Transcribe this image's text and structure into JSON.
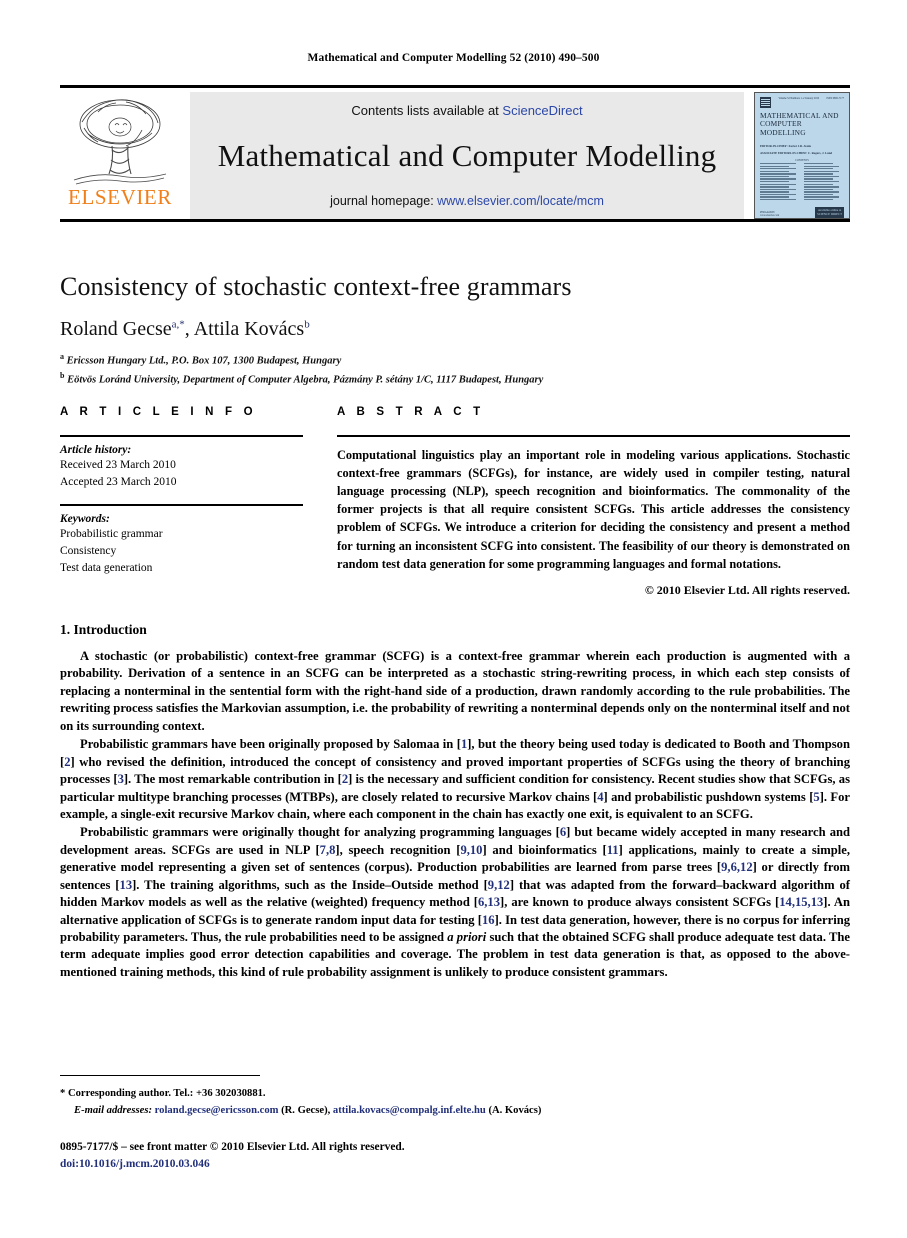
{
  "running_head": "Mathematical and Computer Modelling 52 (2010) 490–500",
  "masthead": {
    "contents_prefix": "Contents lists available at ",
    "sciencedirect": "ScienceDirect",
    "journal_title": "Mathematical and Computer Modelling",
    "homepage_prefix": "journal homepage: ",
    "homepage_url": "www.elsevier.com/locate/mcm",
    "publisher_wordmark": "ELSEVIER",
    "publisher_color": "#F07F1A",
    "link_color": "#2b47a8",
    "band_background": "#e9e9e9",
    "cover": {
      "volume_line": "Volume 52 Numbers 1–2 January 2010",
      "issn_line": "ISSN 0895-7177",
      "title": "MATHEMATICAL AND COMPUTER MODELLING",
      "editors_line_1": "EDITOR-IN-CHIEF: Xavier J.R. Avula",
      "editors_line_2": "ASSOCIATE EDITORS-IN-CHIEF: C. Rogers, J. Lund",
      "contents_label": "CONTENTS",
      "publisher": "PERGAMON",
      "publisher_sub": "www.elsevier.com",
      "badge_line_1": "Available online at",
      "badge_line_2": "SCIENCE DIRECT",
      "background_color": "#bcd6ea"
    }
  },
  "article": {
    "title": "Consistency of stochastic context-free grammars",
    "authors": [
      {
        "name": "Roland Gecse",
        "marks": "a,",
        "corresponding": "*"
      },
      {
        "name": "Attila Kovács",
        "marks": "b",
        "corresponding": ""
      }
    ],
    "author_separator": ", ",
    "affiliations": [
      {
        "mark": "a",
        "text": "Ericsson Hungary Ltd., P.O. Box 107, 1300 Budapest, Hungary"
      },
      {
        "mark": "b",
        "text": "Eötvös Loránd University, Department of Computer Algebra, Pázmány P. sétány 1/C, 1117 Budapest, Hungary"
      }
    ]
  },
  "article_info": {
    "heading": "A R T I C L E   I N F O",
    "history_label": "Article history:",
    "history": [
      "Received 23 March 2010",
      "Accepted 23 March 2010"
    ],
    "keywords_label": "Keywords:",
    "keywords": [
      "Probabilistic grammar",
      "Consistency",
      "Test data generation"
    ]
  },
  "abstract": {
    "heading": "A B S T R A C T",
    "text": "Computational linguistics play an important role in modeling various applications. Stochastic context-free grammars (SCFGs), for instance, are widely used in compiler testing, natural language processing (NLP), speech recognition and bioinformatics. The commonality of the former projects is that all require consistent SCFGs. This article addresses the consistency problem of SCFGs. We introduce a criterion for deciding the consistency and present a method for turning an inconsistent SCFG into consistent. The feasibility of our theory is demonstrated on random test data generation for some programming languages and formal notations.",
    "copyright": "© 2010 Elsevier Ltd. All rights reserved."
  },
  "body": {
    "section_number_title": "1.  Introduction",
    "paragraphs": [
      {
        "segments": [
          {
            "t": "A stochastic (or probabilistic) context-free grammar (SCFG) is a context-free grammar wherein each production is augmented with a probability. Derivation of a sentence in an SCFG can be interpreted as a stochastic string-rewriting process, in which each step consists of replacing a nonterminal in the sentential form with the right-hand side of a production, drawn randomly according to the rule probabilities. The rewriting process satisfies the Markovian assumption, i.e. the probability of rewriting a nonterminal depends only on the nonterminal itself and not on its surrounding context.",
            "k": "text"
          }
        ]
      },
      {
        "segments": [
          {
            "t": "Probabilistic grammars have been originally proposed by Salomaa in [",
            "k": "text"
          },
          {
            "t": "1",
            "k": "ref"
          },
          {
            "t": "], but the theory being used today is dedicated to Booth and Thompson [",
            "k": "text"
          },
          {
            "t": "2",
            "k": "ref"
          },
          {
            "t": "] who revised the definition, introduced the concept of consistency and proved important properties of SCFGs using the theory of branching processes [",
            "k": "text"
          },
          {
            "t": "3",
            "k": "ref"
          },
          {
            "t": "]. The most remarkable contribution in [",
            "k": "text"
          },
          {
            "t": "2",
            "k": "ref"
          },
          {
            "t": "] is the necessary and sufficient condition for consistency. Recent studies show that SCFGs, as particular multitype branching processes (MTBPs), are closely related to recursive Markov chains [",
            "k": "text"
          },
          {
            "t": "4",
            "k": "ref"
          },
          {
            "t": "] and probabilistic pushdown systems [",
            "k": "text"
          },
          {
            "t": "5",
            "k": "ref"
          },
          {
            "t": "]. For example, a single-exit recursive Markov chain, where each component in the chain has exactly one exit, is equivalent to an SCFG.",
            "k": "text"
          }
        ]
      },
      {
        "segments": [
          {
            "t": "Probabilistic grammars were originally thought for analyzing programming languages [",
            "k": "text"
          },
          {
            "t": "6",
            "k": "ref"
          },
          {
            "t": "] but became widely accepted in many research and development areas. SCFGs are used in NLP [",
            "k": "text"
          },
          {
            "t": "7,8",
            "k": "ref"
          },
          {
            "t": "], speech recognition [",
            "k": "text"
          },
          {
            "t": "9,10",
            "k": "ref"
          },
          {
            "t": "] and bioinformatics [",
            "k": "text"
          },
          {
            "t": "11",
            "k": "ref"
          },
          {
            "t": "] applications, mainly to create a simple, generative model representing a given set of sentences (corpus). Production probabilities are learned from parse trees [",
            "k": "text"
          },
          {
            "t": "9,6,12",
            "k": "ref"
          },
          {
            "t": "] or directly from sentences [",
            "k": "text"
          },
          {
            "t": "13",
            "k": "ref"
          },
          {
            "t": "]. The training algorithms, such as the Inside–Outside method [",
            "k": "text"
          },
          {
            "t": "9,12",
            "k": "ref"
          },
          {
            "t": "] that was adapted from the forward–backward algorithm of hidden Markov models as well as the relative (weighted) frequency method [",
            "k": "text"
          },
          {
            "t": "6,13",
            "k": "ref"
          },
          {
            "t": "], are known to produce always consistent SCFGs [",
            "k": "text"
          },
          {
            "t": "14,15,13",
            "k": "ref"
          },
          {
            "t": "]. An alternative application of SCFGs is to generate random input data for testing [",
            "k": "text"
          },
          {
            "t": "16",
            "k": "ref"
          },
          {
            "t": "]. In test data generation, however, there is no corpus for inferring probability parameters. Thus, the rule probabilities need to be assigned ",
            "k": "text"
          },
          {
            "t": "a priori",
            "k": "italic"
          },
          {
            "t": " such that the obtained SCFG shall produce adequate test data. The term adequate implies good error detection capabilities and coverage. The problem in test data generation is that, as opposed to the above-mentioned training methods, this kind of rule probability assignment is unlikely to produce consistent grammars.",
            "k": "text"
          }
        ]
      }
    ]
  },
  "footer": {
    "corresponding_note": "*  Corresponding author. Tel.: +36 302030881.",
    "email_label": "E-mail addresses:",
    "emails": [
      {
        "address": "roland.gecse@ericsson.com",
        "owner": "(R. Gecse)"
      },
      {
        "address": "attila.kovacs@compalg.inf.elte.hu",
        "owner": "(A. Kovács)"
      }
    ],
    "imprint": "0895-7177/$ – see front matter © 2010 Elsevier Ltd. All rights reserved.",
    "doi": "doi:10.1016/j.mcm.2010.03.046"
  }
}
